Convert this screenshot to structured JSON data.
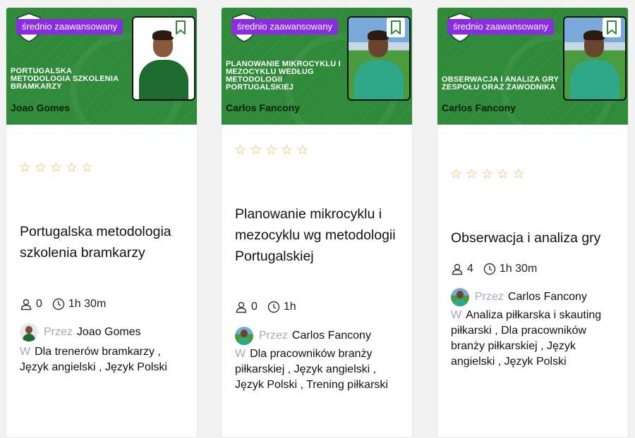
{
  "courses": [
    {
      "level": "średnio zaawansowany",
      "banner_title": "Portugalska metodologia szkolenia bramkarzy",
      "banner_author": "Joao Gomes",
      "title": "Portugalska metodologia szkolenia bramkarzy",
      "students": "0",
      "duration": "1h 30m",
      "by_label": "Przez",
      "author": "Joao Gomes",
      "cat_icon": "W",
      "categories": "Dla trenerów bramkarzy , Język angielski , Język Polski"
    },
    {
      "level": "średnio zaawansowany",
      "banner_title": "Planowanie mikrocyklu i mezocyklu według metodologii portugalskiej",
      "banner_author": "Carlos Fancony",
      "title": "Planowanie mikrocyklu i mezocyklu wg metodologii Portugalskiej",
      "students": "0",
      "duration": "1h",
      "by_label": "Przez",
      "author": "Carlos Fancony",
      "cat_icon": "W",
      "categories": "Dla pracowników branży piłkarskiej , Język angielski , Język Polski , Trening piłkarski"
    },
    {
      "level": "średnio zaawansowany",
      "banner_title": "Obserwacja i analiza gry zespołu oraz zawodnika",
      "banner_author": "Carlos Fancony",
      "title": "Obserwacja i analiza gry",
      "students": "4",
      "duration": "1h 30m",
      "by_label": "Przez",
      "author": "Carlos Fancony",
      "cat_icon": "W",
      "categories": "Analiza piłkarska i skauting piłkarski , Dla pracowników branży piłkarskiej , Język angielski , Język Polski"
    }
  ],
  "colors": {
    "banner_green": "#2f8a39",
    "level_badge": "#8b2be2",
    "star": "#e8b54a",
    "muted": "#a3a8b2"
  },
  "icons": [
    "shield-logo-icon",
    "bookmark-icon",
    "star-outline-icon",
    "user-icon",
    "clock-icon"
  ]
}
